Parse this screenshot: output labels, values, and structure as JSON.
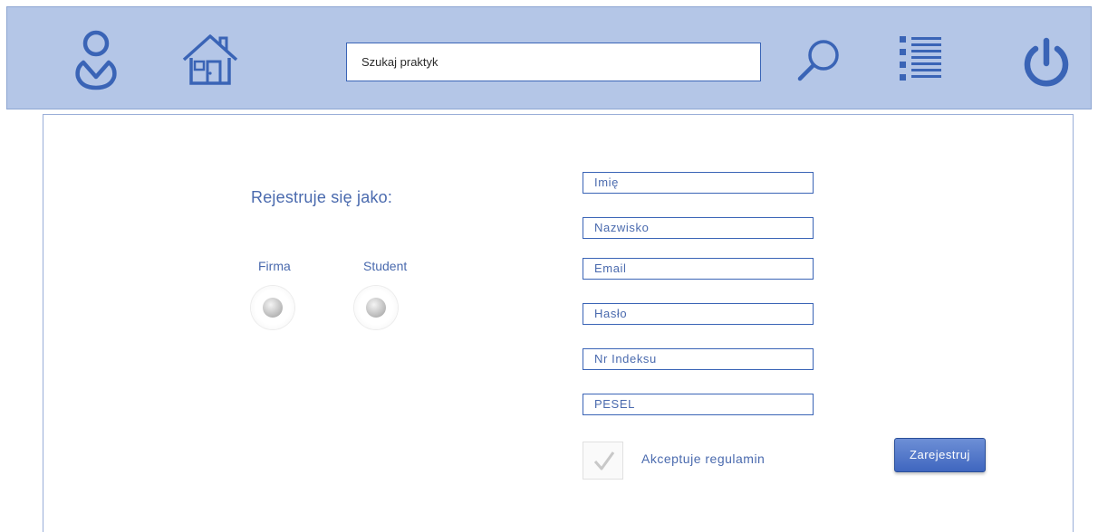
{
  "header": {
    "search": {
      "placeholder": "Szukaj praktyk"
    },
    "icons": [
      "user-icon",
      "home-icon",
      "search-icon",
      "menu-list-icon",
      "power-icon"
    ]
  },
  "form": {
    "title": "Rejestruje się jako:",
    "options": [
      {
        "label": "Firma",
        "selected": false
      },
      {
        "label": "Student",
        "selected": false
      }
    ],
    "fields": [
      {
        "label": "Imię"
      },
      {
        "label": "Nazwisko"
      },
      {
        "label": "Email"
      },
      {
        "label": "Hasło"
      },
      {
        "label": "Nr Indeksu"
      },
      {
        "label": "PESEL"
      }
    ],
    "terms": {
      "label": "Akceptuje regulamin",
      "checked": true
    },
    "submit_label": "Zarejestruj"
  },
  "colors": {
    "header_bg": "#b4c6e7",
    "accent": "#3a64b6",
    "text": "#4a6aae"
  }
}
